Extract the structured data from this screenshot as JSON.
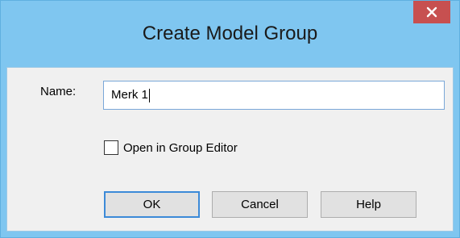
{
  "dialog": {
    "title": "Create Model Group",
    "close_glyph": "✕"
  },
  "form": {
    "name_label": "Name:",
    "name_value": "Merk 1",
    "open_in_editor_label": "Open in Group Editor",
    "open_in_editor_checked": false
  },
  "buttons": {
    "ok_label": "OK",
    "cancel_label": "Cancel",
    "help_label": "Help"
  },
  "colors": {
    "titlebar": "#7fc6f0",
    "close_button": "#c75050",
    "client_bg": "#f0f0f0",
    "focus_border": "#3c8ad8"
  }
}
